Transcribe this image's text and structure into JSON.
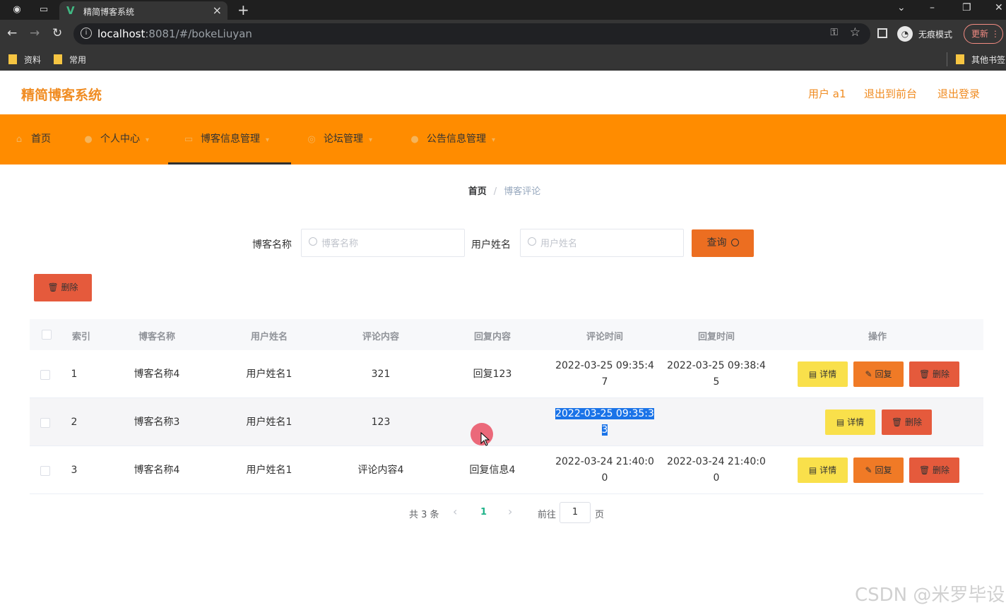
{
  "browser": {
    "tab_title": "精简博客系统",
    "url_host": "localhost",
    "url_rest": ":8081/#/bokeLiuyan",
    "incognito_label": "无痕模式",
    "update_label": "更新",
    "bookmarks": [
      "资料",
      "常用",
      "其他书签"
    ]
  },
  "header": {
    "app_title": "精简博客系统",
    "user": "用户 a1",
    "to_front": "退出到前台",
    "logout": "退出登录"
  },
  "menu": {
    "items": [
      {
        "label": "首页",
        "icon": "home-icon"
      },
      {
        "label": "个人中心",
        "icon": "user-icon"
      },
      {
        "label": "博客信息管理",
        "icon": "blog-icon"
      },
      {
        "label": "论坛管理",
        "icon": "forum-icon"
      },
      {
        "label": "公告信息管理",
        "icon": "notice-icon"
      }
    ],
    "active_index": 2
  },
  "breadcrumb": {
    "home": "首页",
    "separator": "/",
    "current": "博客评论"
  },
  "search": {
    "blog_label": "博客名称",
    "blog_placeholder": "博客名称",
    "user_label": "用户姓名",
    "user_placeholder": "用户姓名",
    "query_label": "查询"
  },
  "toolbar": {
    "batch_delete_label": "删除"
  },
  "table": {
    "columns": [
      "索引",
      "博客名称",
      "用户姓名",
      "评论内容",
      "回复内容",
      "评论时间",
      "回复时间",
      "操作"
    ],
    "rows": [
      {
        "index": "1",
        "blog": "博客名称4",
        "user": "用户姓名1",
        "content": "321",
        "reply": "回复123",
        "comment_time_a": "2022-03-25 09:35:4",
        "comment_time_b": "7",
        "reply_time_a": "2022-03-25 09:38:4",
        "reply_time_b": "5"
      },
      {
        "index": "2",
        "blog": "博客名称3",
        "user": "用户姓名1",
        "content": "123",
        "reply": "",
        "comment_time_a": "2022-03-25 09:35:3",
        "comment_time_b": "3",
        "reply_time_a": "",
        "reply_time_b": ""
      },
      {
        "index": "3",
        "blog": "博客名称4",
        "user": "用户姓名1",
        "content": "评论内容4",
        "reply": "回复信息4",
        "comment_time_a": "2022-03-24 21:40:0",
        "comment_time_b": "0",
        "reply_time_a": "2022-03-24 21:40:0",
        "reply_time_b": "0"
      }
    ],
    "actions": {
      "detail": "详情",
      "reply": "回复",
      "delete": "删除"
    }
  },
  "pagination": {
    "total": "共 3 条",
    "prev": "‹",
    "current_page": "1",
    "next": "›",
    "goto": "前往",
    "goto_value": "1",
    "page_unit": "页"
  },
  "watermark": "CSDN @米罗毕设",
  "colors": {
    "accent": "#ff8c00",
    "brand_text": "#f08c22",
    "detail": "#f9e04b",
    "reply": "#f07a26",
    "delete": "#e55a3c"
  }
}
